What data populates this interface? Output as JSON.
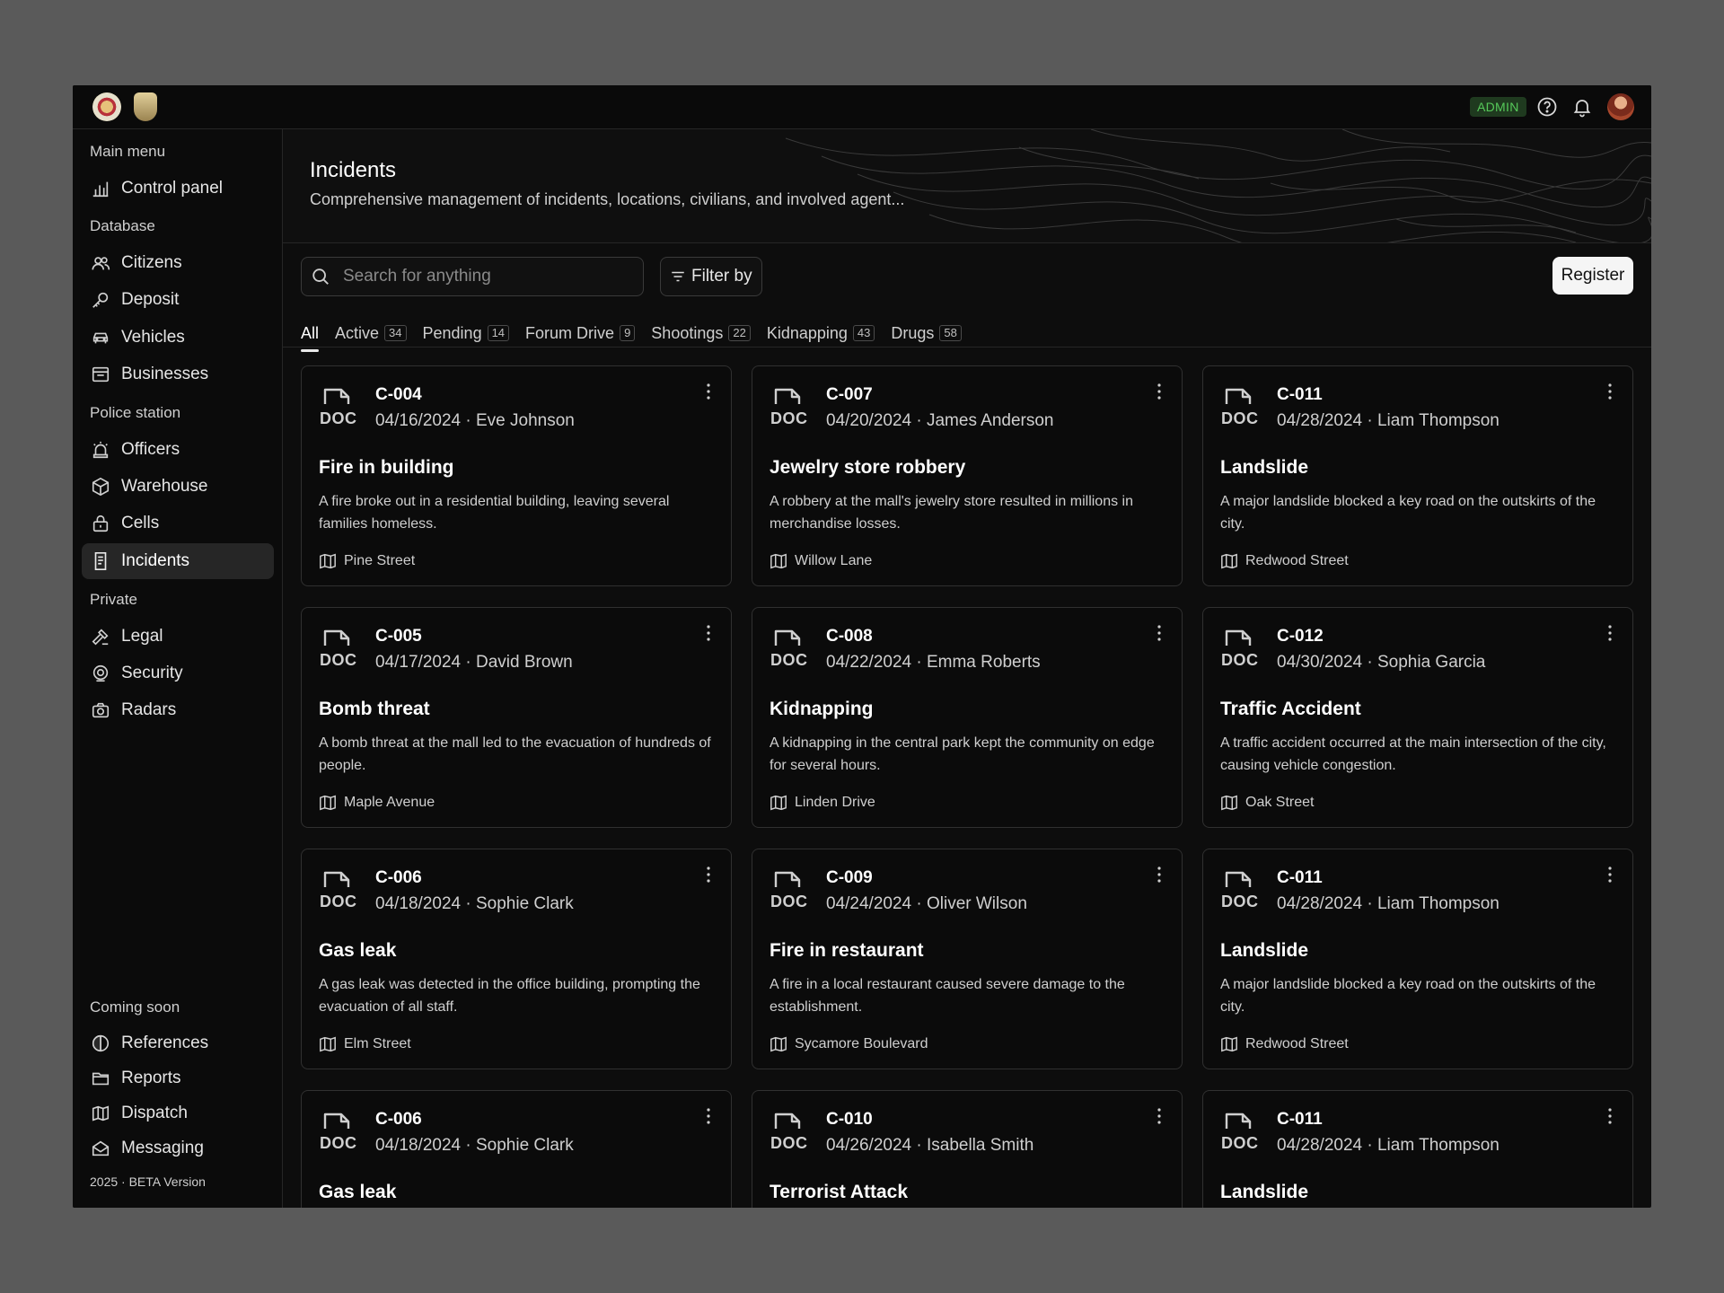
{
  "header": {
    "admin_label": "ADMIN",
    "icons": [
      "crest-logo",
      "badge-logo",
      "help-icon",
      "bell-icon",
      "avatar"
    ]
  },
  "sidebar": {
    "sections": [
      {
        "label": "Main menu",
        "items": [
          {
            "label": "Control panel",
            "icon": "chart-icon"
          }
        ]
      },
      {
        "label": "Database",
        "items": [
          {
            "label": "Citizens",
            "icon": "users-icon"
          },
          {
            "label": "Deposit",
            "icon": "key-icon"
          },
          {
            "label": "Vehicles",
            "icon": "car-icon"
          },
          {
            "label": "Businesses",
            "icon": "store-icon"
          }
        ]
      },
      {
        "label": "Police station",
        "items": [
          {
            "label": "Officers",
            "icon": "siren-icon"
          },
          {
            "label": "Warehouse",
            "icon": "box-icon"
          },
          {
            "label": "Cells",
            "icon": "lock-icon"
          },
          {
            "label": "Incidents",
            "icon": "report-icon",
            "active": true
          }
        ]
      },
      {
        "label": "Private",
        "items": [
          {
            "label": "Legal",
            "icon": "gavel-icon"
          },
          {
            "label": "Security",
            "icon": "shield-icon"
          },
          {
            "label": "Radars",
            "icon": "camera-icon"
          }
        ]
      },
      {
        "label": "Coming soon",
        "items": [
          {
            "label": "References",
            "icon": "half-circle-icon"
          },
          {
            "label": "Reports",
            "icon": "folder-icon"
          },
          {
            "label": "Dispatch",
            "icon": "map-icon"
          },
          {
            "label": "Messaging",
            "icon": "mail-icon"
          }
        ]
      }
    ],
    "footer": "2025 · BETA Version"
  },
  "page": {
    "title": "Incidents",
    "description": "Comprehensive management of incidents, locations, civilians, and involved agent...",
    "search_placeholder": "Search for anything",
    "filter_label": "Filter by",
    "register_label": "Register"
  },
  "tabs": [
    {
      "label": "All",
      "count": null,
      "active": true
    },
    {
      "label": "Active",
      "count": "34"
    },
    {
      "label": "Pending",
      "count": "14"
    },
    {
      "label": "Forum Drive",
      "count": "9"
    },
    {
      "label": "Shootings",
      "count": "22"
    },
    {
      "label": "Kidnapping",
      "count": "43"
    },
    {
      "label": "Drugs",
      "count": "58"
    }
  ],
  "cards": [
    {
      "id": "C-004",
      "meta": "04/16/2024 · Eve Johnson",
      "title": "Fire in building",
      "description": "A fire broke out in a residential building, leaving several families homeless.",
      "location": "Pine Street"
    },
    {
      "id": "C-007",
      "meta": "04/20/2024 · James Anderson",
      "title": "Jewelry store robbery",
      "description": "A robbery at the mall's jewelry store resulted in millions in merchandise losses.",
      "location": "Willow Lane"
    },
    {
      "id": "C-011",
      "meta": "04/28/2024 · Liam Thompson",
      "title": "Landslide",
      "description": "A major landslide blocked a key road on the outskirts of the city.",
      "location": "Redwood Street"
    },
    {
      "id": "C-005",
      "meta": "04/17/2024 · David Brown",
      "title": "Bomb threat",
      "description": "A bomb threat at the mall led to the evacuation of hundreds of people.",
      "location": "Maple Avenue"
    },
    {
      "id": "C-008",
      "meta": "04/22/2024 · Emma Roberts",
      "title": "Kidnapping",
      "description": "A kidnapping in the central park kept the community on edge for several hours.",
      "location": "Linden Drive"
    },
    {
      "id": "C-012",
      "meta": "04/30/2024 · Sophia Garcia",
      "title": "Traffic Accident",
      "description": "A traffic accident occurred at the main intersection of the city, causing vehicle congestion.",
      "location": "Oak Street"
    },
    {
      "id": "C-006",
      "meta": "04/18/2024 · Sophie Clark",
      "title": "Gas leak",
      "description": "A gas leak was detected in the office building, prompting the evacuation of all staff.",
      "location": "Elm Street"
    },
    {
      "id": "C-009",
      "meta": "04/24/2024 · Oliver Wilson",
      "title": "Fire in restaurant",
      "description": "A fire in a local restaurant caused severe damage to the establishment.",
      "location": "Sycamore Boulevard"
    },
    {
      "id": "C-011",
      "meta": "04/28/2024 · Liam Thompson",
      "title": "Landslide",
      "description": "A major landslide blocked a key road on the outskirts of the city.",
      "location": "Redwood Street"
    },
    {
      "id": "C-006",
      "meta": "04/18/2024 · Sophie Clark",
      "title": "Gas leak",
      "description": "",
      "location": ""
    },
    {
      "id": "C-010",
      "meta": "04/26/2024 · Isabella Smith",
      "title": "Terrorist Attack",
      "description": "",
      "location": ""
    },
    {
      "id": "C-011",
      "meta": "04/28/2024 · Liam Thompson",
      "title": "Landslide",
      "description": "",
      "location": ""
    }
  ]
}
